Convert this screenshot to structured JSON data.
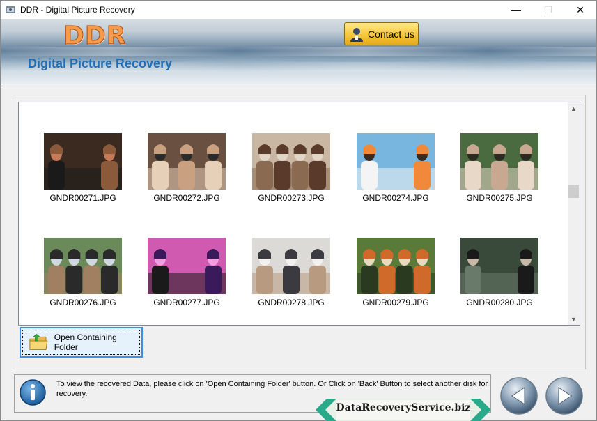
{
  "window": {
    "title": "DDR - Digital Picture Recovery",
    "controls": {
      "minimize": "—",
      "maximize": "☐",
      "close": "✕"
    }
  },
  "banner": {
    "logo": "DDR",
    "subtitle": "Digital Picture Recovery",
    "contact_label": "Contact us",
    "contact_icon": "person-icon"
  },
  "gallery": {
    "items": [
      {
        "name": "GNDR00271.JPG",
        "palette": [
          "#3a2a20",
          "#8a5a3a",
          "#c77a5a",
          "#1a1a1a"
        ]
      },
      {
        "name": "GNDR00272.JPG",
        "palette": [
          "#6a5040",
          "#c9a080",
          "#2a2a2a",
          "#e6d0b8"
        ]
      },
      {
        "name": "GNDR00273.JPG",
        "palette": [
          "#c9b7a4",
          "#5a3a2a",
          "#e2d6c8",
          "#8a6a50"
        ]
      },
      {
        "name": "GNDR00274.JPG",
        "palette": [
          "#78b6e0",
          "#f08a3a",
          "#3a2a20",
          "#f4f4f4"
        ]
      },
      {
        "name": "GNDR00275.JPG",
        "palette": [
          "#4a6a40",
          "#c8a890",
          "#2a2a20",
          "#e8d8c8"
        ]
      },
      {
        "name": "GNDR00276.JPG",
        "palette": [
          "#6a8a5a",
          "#2a2a2a",
          "#d0d8e0",
          "#a08060"
        ]
      },
      {
        "name": "GNDR00277.JPG",
        "palette": [
          "#d05ab0",
          "#3a1a5a",
          "#f0a0e0",
          "#1a1a1a"
        ]
      },
      {
        "name": "GNDR00278.JPG",
        "palette": [
          "#dcdad6",
          "#3a3a40",
          "#f4f2ee",
          "#b89a80"
        ]
      },
      {
        "name": "GNDR00279.JPG",
        "palette": [
          "#5a7a3a",
          "#d06a2a",
          "#e8d8c0",
          "#2a3a20"
        ]
      },
      {
        "name": "GNDR00280.JPG",
        "palette": [
          "#3a4a3a",
          "#1a1a1a",
          "#c8b8a8",
          "#6a7a6a"
        ]
      }
    ]
  },
  "scrollbar": {
    "up": "▲",
    "down": "▼"
  },
  "open_folder": {
    "label": "Open Containing Folder",
    "icon": "folder-icon"
  },
  "info": {
    "icon": "info-icon",
    "text": "To view the recovered Data, please click on 'Open Containing Folder' button. Or Click on 'Back' Button to select another disk for recovery."
  },
  "nav": {
    "back_icon": "back-arrow-icon",
    "next_icon": "next-arrow-icon"
  },
  "footer": {
    "site": "DataRecoveryService.biz"
  },
  "colors": {
    "accent": "#3a8ee6",
    "subtitle": "#1f6fb8",
    "logo": "#f39b4a",
    "contact_button": "#f7c73c"
  }
}
